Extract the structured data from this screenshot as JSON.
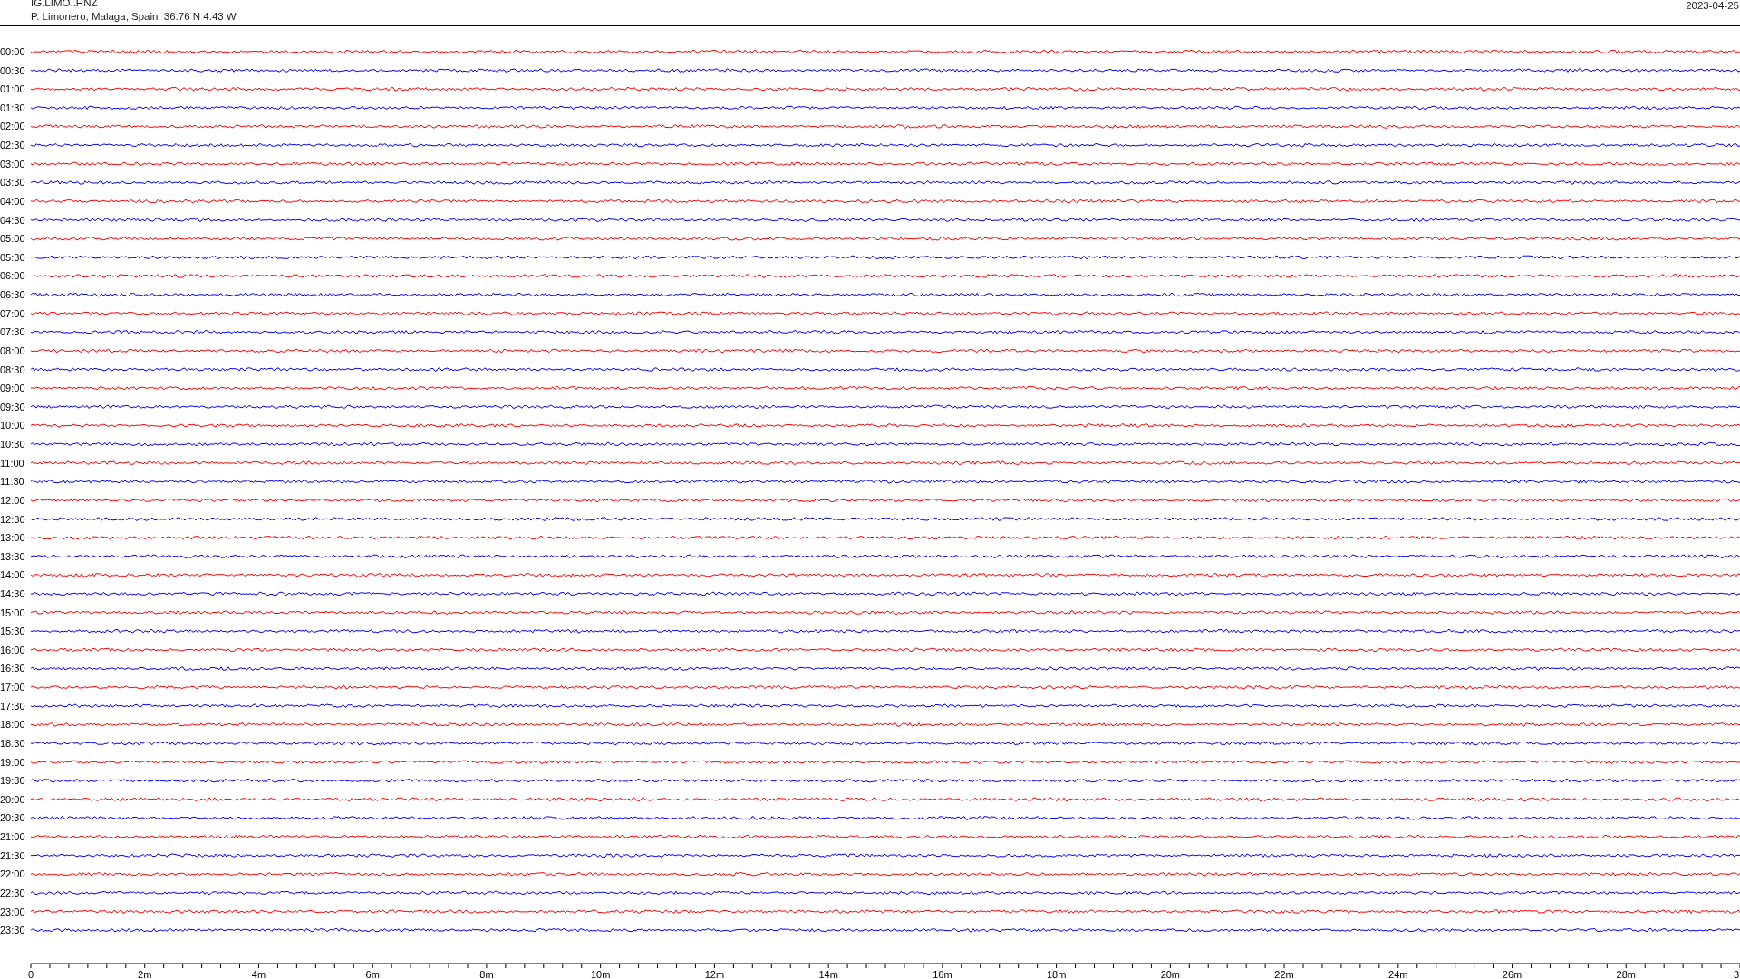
{
  "header": {
    "station": "IG.LIMO..HNZ",
    "location": "P. Limonero, Malaga, Spain  36.76 N 4.43 W",
    "date": "2023-04-25"
  },
  "traces": [
    {
      "label": "00:00",
      "color": "#ff0000"
    },
    {
      "label": "00:30",
      "color": "#0000ff"
    },
    {
      "label": "01:00",
      "color": "#ff0000"
    },
    {
      "label": "01:30",
      "color": "#0000ff"
    },
    {
      "label": "02:00",
      "color": "#ff0000"
    },
    {
      "label": "02:30",
      "color": "#0000ff"
    },
    {
      "label": "03:00",
      "color": "#ff0000"
    },
    {
      "label": "03:30",
      "color": "#0000ff"
    },
    {
      "label": "04:00",
      "color": "#ff0000"
    },
    {
      "label": "04:30",
      "color": "#0000ff"
    },
    {
      "label": "05:00",
      "color": "#ff0000"
    },
    {
      "label": "05:30",
      "color": "#0000ff"
    },
    {
      "label": "06:00",
      "color": "#ff0000"
    },
    {
      "label": "06:30",
      "color": "#0000ff"
    },
    {
      "label": "07:00",
      "color": "#ff0000"
    },
    {
      "label": "07:30",
      "color": "#0000ff"
    },
    {
      "label": "08:00",
      "color": "#ff0000"
    },
    {
      "label": "08:30",
      "color": "#0000ff"
    },
    {
      "label": "09:00",
      "color": "#ff0000"
    },
    {
      "label": "09:30",
      "color": "#0000ff"
    },
    {
      "label": "10:00",
      "color": "#ff0000"
    },
    {
      "label": "10:30",
      "color": "#0000ff"
    },
    {
      "label": "11:00",
      "color": "#ff0000"
    },
    {
      "label": "11:30",
      "color": "#0000ff"
    },
    {
      "label": "12:00",
      "color": "#ff0000"
    },
    {
      "label": "12:30",
      "color": "#0000ff"
    },
    {
      "label": "13:00",
      "color": "#ff0000"
    },
    {
      "label": "13:30",
      "color": "#0000ff"
    },
    {
      "label": "14:00",
      "color": "#ff0000"
    },
    {
      "label": "14:30",
      "color": "#0000ff"
    },
    {
      "label": "15:00",
      "color": "#ff0000"
    },
    {
      "label": "15:30",
      "color": "#0000ff"
    },
    {
      "label": "16:00",
      "color": "#ff0000"
    },
    {
      "label": "16:30",
      "color": "#0000ff"
    },
    {
      "label": "17:00",
      "color": "#ff0000"
    },
    {
      "label": "17:30",
      "color": "#0000ff"
    },
    {
      "label": "18:00",
      "color": "#ff0000"
    },
    {
      "label": "18:30",
      "color": "#0000ff"
    },
    {
      "label": "19:00",
      "color": "#ff0000"
    },
    {
      "label": "19:30",
      "color": "#0000ff"
    },
    {
      "label": "20:00",
      "color": "#ff0000"
    },
    {
      "label": "20:30",
      "color": "#0000ff"
    },
    {
      "label": "21:00",
      "color": "#ff0000"
    },
    {
      "label": "21:30",
      "color": "#0000ff"
    },
    {
      "label": "22:00",
      "color": "#ff0000"
    },
    {
      "label": "22:30",
      "color": "#0000ff"
    },
    {
      "label": "23:00",
      "color": "#ff0000"
    },
    {
      "label": "23:30",
      "color": "#0000ff"
    }
  ],
  "axis_labels": [
    "0",
    "2m",
    "4m",
    "6m",
    "8m",
    "10m",
    "12m",
    "14m",
    "16m",
    "18m",
    "20m",
    "22m",
    "24m",
    "26m",
    "28m",
    "3"
  ]
}
